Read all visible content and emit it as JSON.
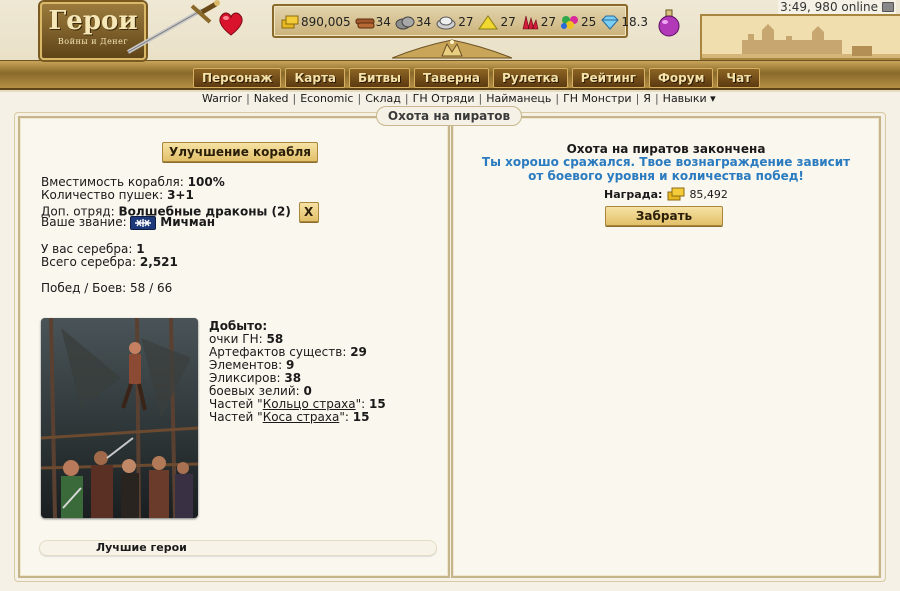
{
  "header": {
    "logo": {
      "title": "Герои",
      "subtitle": "Войны и Денег"
    },
    "clock": "3:49, 980 online",
    "resources": [
      {
        "icon": "gold-icon",
        "value": "890,005"
      },
      {
        "icon": "wood-icon",
        "value": "34"
      },
      {
        "icon": "ore-icon",
        "value": "34"
      },
      {
        "icon": "mercury-icon",
        "value": "27"
      },
      {
        "icon": "sulfur-icon",
        "value": "27"
      },
      {
        "icon": "crystal-icon",
        "value": "27"
      },
      {
        "icon": "gems-icon",
        "value": "25"
      },
      {
        "icon": "diamond-icon",
        "value": "18.3"
      }
    ]
  },
  "mainmenu": [
    "Персонаж",
    "Карта",
    "Битвы",
    "Таверна",
    "Рулетка",
    "Рейтинг",
    "Форум",
    "Чат"
  ],
  "submenu": [
    "Warrior",
    "Naked",
    "Economic",
    "Склад",
    "ГН Отряди",
    "Найманець",
    "ГН Монстри",
    "Я",
    "Навыки ▾"
  ],
  "page_title": "Охота на пиратов",
  "left": {
    "upgrade_button": "Улучшение корабля",
    "stats": {
      "capacity_label": "Вместимость корабля:",
      "capacity_value": "100%",
      "guns_label": "Количество пушек:",
      "guns_value": "3+1",
      "extra_label": "Доп. отряд:",
      "extra_value": "Волшебные драконы (2)",
      "remove_button": "X",
      "rank_label": "Ваше звание:",
      "rank_value": "Мичман",
      "silver_label": "У вас серебра:",
      "silver_value": "1",
      "silver_total_label": "Всего серебра:",
      "silver_total_value": "2,521",
      "wins_label": "Побед / Боев:",
      "wins_value": "58 / 66"
    },
    "loot": {
      "heading": "Добыто:",
      "gn_label": "очки ГН:",
      "gn_value": "58",
      "arts_label": "Артефактов существ:",
      "arts_value": "29",
      "elements_label": "Элементов:",
      "elements_value": "9",
      "elixirs_label": "Эликсиров:",
      "elixirs_value": "38",
      "potions_label": "боевых зелий:",
      "potions_value": "0",
      "parts1_prefix": "Частей \"",
      "parts1_link": "Кольцо страха",
      "parts1_suffix": "\":",
      "parts1_value": "15",
      "parts2_prefix": "Частей \"",
      "parts2_link": "Коса страха",
      "parts2_suffix": "\":",
      "parts2_value": "15"
    },
    "best_heroes": "Лучшие герои"
  },
  "right": {
    "title": "Охота на пиратов закончена",
    "message": "Ты хорошо сражался. Твое вознаграждение зависит от боевого уровня и количества побед!",
    "reward_label": "Награда:",
    "reward_value": "85,492",
    "take_button": "Забрать"
  },
  "colors": {
    "accent_gold": "#e2c06a",
    "menu_brown": "#5c3a10",
    "message_blue": "#2a7bc0"
  }
}
